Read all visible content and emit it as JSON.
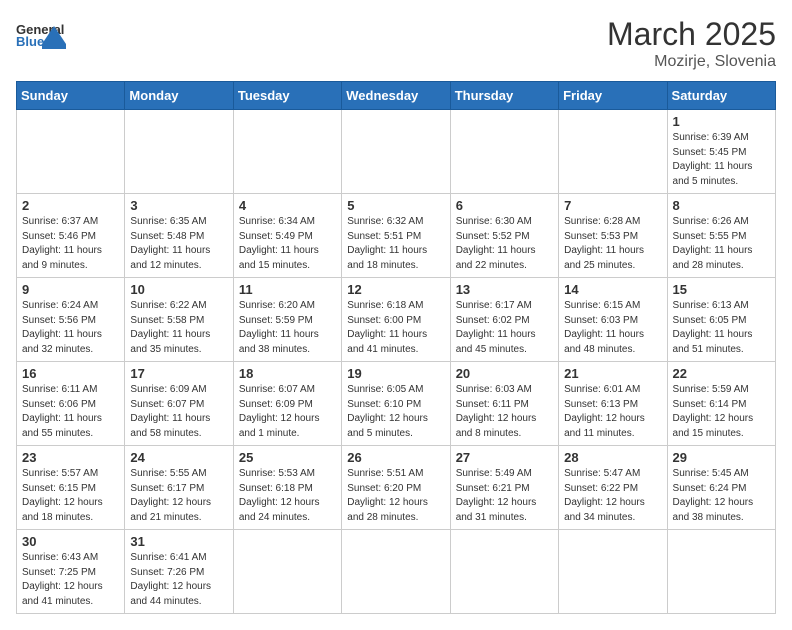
{
  "header": {
    "logo_general": "General",
    "logo_blue": "Blue",
    "month_title": "March 2025",
    "location": "Mozirje, Slovenia"
  },
  "weekdays": [
    "Sunday",
    "Monday",
    "Tuesday",
    "Wednesday",
    "Thursday",
    "Friday",
    "Saturday"
  ],
  "days": {
    "d1": {
      "num": "1",
      "sunrise": "6:39 AM",
      "sunset": "5:45 PM",
      "daylight": "11 hours and 5 minutes."
    },
    "d2": {
      "num": "2",
      "sunrise": "6:37 AM",
      "sunset": "5:46 PM",
      "daylight": "11 hours and 9 minutes."
    },
    "d3": {
      "num": "3",
      "sunrise": "6:35 AM",
      "sunset": "5:48 PM",
      "daylight": "11 hours and 12 minutes."
    },
    "d4": {
      "num": "4",
      "sunrise": "6:34 AM",
      "sunset": "5:49 PM",
      "daylight": "11 hours and 15 minutes."
    },
    "d5": {
      "num": "5",
      "sunrise": "6:32 AM",
      "sunset": "5:51 PM",
      "daylight": "11 hours and 18 minutes."
    },
    "d6": {
      "num": "6",
      "sunrise": "6:30 AM",
      "sunset": "5:52 PM",
      "daylight": "11 hours and 22 minutes."
    },
    "d7": {
      "num": "7",
      "sunrise": "6:28 AM",
      "sunset": "5:53 PM",
      "daylight": "11 hours and 25 minutes."
    },
    "d8": {
      "num": "8",
      "sunrise": "6:26 AM",
      "sunset": "5:55 PM",
      "daylight": "11 hours and 28 minutes."
    },
    "d9": {
      "num": "9",
      "sunrise": "6:24 AM",
      "sunset": "5:56 PM",
      "daylight": "11 hours and 32 minutes."
    },
    "d10": {
      "num": "10",
      "sunrise": "6:22 AM",
      "sunset": "5:58 PM",
      "daylight": "11 hours and 35 minutes."
    },
    "d11": {
      "num": "11",
      "sunrise": "6:20 AM",
      "sunset": "5:59 PM",
      "daylight": "11 hours and 38 minutes."
    },
    "d12": {
      "num": "12",
      "sunrise": "6:18 AM",
      "sunset": "6:00 PM",
      "daylight": "11 hours and 41 minutes."
    },
    "d13": {
      "num": "13",
      "sunrise": "6:17 AM",
      "sunset": "6:02 PM",
      "daylight": "11 hours and 45 minutes."
    },
    "d14": {
      "num": "14",
      "sunrise": "6:15 AM",
      "sunset": "6:03 PM",
      "daylight": "11 hours and 48 minutes."
    },
    "d15": {
      "num": "15",
      "sunrise": "6:13 AM",
      "sunset": "6:05 PM",
      "daylight": "11 hours and 51 minutes."
    },
    "d16": {
      "num": "16",
      "sunrise": "6:11 AM",
      "sunset": "6:06 PM",
      "daylight": "11 hours and 55 minutes."
    },
    "d17": {
      "num": "17",
      "sunrise": "6:09 AM",
      "sunset": "6:07 PM",
      "daylight": "11 hours and 58 minutes."
    },
    "d18": {
      "num": "18",
      "sunrise": "6:07 AM",
      "sunset": "6:09 PM",
      "daylight": "12 hours and 1 minute."
    },
    "d19": {
      "num": "19",
      "sunrise": "6:05 AM",
      "sunset": "6:10 PM",
      "daylight": "12 hours and 5 minutes."
    },
    "d20": {
      "num": "20",
      "sunrise": "6:03 AM",
      "sunset": "6:11 PM",
      "daylight": "12 hours and 8 minutes."
    },
    "d21": {
      "num": "21",
      "sunrise": "6:01 AM",
      "sunset": "6:13 PM",
      "daylight": "12 hours and 11 minutes."
    },
    "d22": {
      "num": "22",
      "sunrise": "5:59 AM",
      "sunset": "6:14 PM",
      "daylight": "12 hours and 15 minutes."
    },
    "d23": {
      "num": "23",
      "sunrise": "5:57 AM",
      "sunset": "6:15 PM",
      "daylight": "12 hours and 18 minutes."
    },
    "d24": {
      "num": "24",
      "sunrise": "5:55 AM",
      "sunset": "6:17 PM",
      "daylight": "12 hours and 21 minutes."
    },
    "d25": {
      "num": "25",
      "sunrise": "5:53 AM",
      "sunset": "6:18 PM",
      "daylight": "12 hours and 24 minutes."
    },
    "d26": {
      "num": "26",
      "sunrise": "5:51 AM",
      "sunset": "6:20 PM",
      "daylight": "12 hours and 28 minutes."
    },
    "d27": {
      "num": "27",
      "sunrise": "5:49 AM",
      "sunset": "6:21 PM",
      "daylight": "12 hours and 31 minutes."
    },
    "d28": {
      "num": "28",
      "sunrise": "5:47 AM",
      "sunset": "6:22 PM",
      "daylight": "12 hours and 34 minutes."
    },
    "d29": {
      "num": "29",
      "sunrise": "5:45 AM",
      "sunset": "6:24 PM",
      "daylight": "12 hours and 38 minutes."
    },
    "d30": {
      "num": "30",
      "sunrise": "6:43 AM",
      "sunset": "7:25 PM",
      "daylight": "12 hours and 41 minutes."
    },
    "d31": {
      "num": "31",
      "sunrise": "6:41 AM",
      "sunset": "7:26 PM",
      "daylight": "12 hours and 44 minutes."
    }
  }
}
